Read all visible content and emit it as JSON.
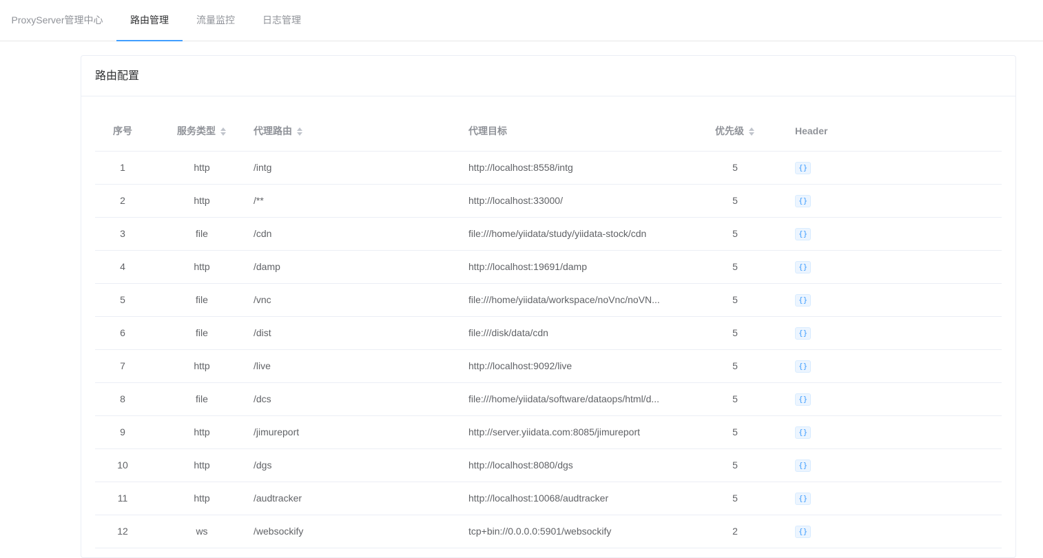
{
  "nav": {
    "brand": "ProxyServer管理中心",
    "tabs": [
      {
        "label": "路由管理",
        "active": true
      },
      {
        "label": "流量监控",
        "active": false
      },
      {
        "label": "日志管理",
        "active": false
      }
    ]
  },
  "card": {
    "title": "路由配置"
  },
  "table": {
    "columns": {
      "index": "序号",
      "type": "服务类型",
      "route": "代理路由",
      "target": "代理目标",
      "priority": "优先级",
      "header": "Header"
    },
    "rows": [
      {
        "index": "1",
        "type": "http",
        "route": "/intg",
        "target": "http://localhost:8558/intg",
        "priority": "5",
        "header": "{}"
      },
      {
        "index": "2",
        "type": "http",
        "route": "/**",
        "target": "http://localhost:33000/",
        "priority": "5",
        "header": "{}"
      },
      {
        "index": "3",
        "type": "file",
        "route": "/cdn",
        "target": "file:///home/yiidata/study/yiidata-stock/cdn",
        "priority": "5",
        "header": "{}"
      },
      {
        "index": "4",
        "type": "http",
        "route": "/damp",
        "target": "http://localhost:19691/damp",
        "priority": "5",
        "header": "{}"
      },
      {
        "index": "5",
        "type": "file",
        "route": "/vnc",
        "target": "file:///home/yiidata/workspace/noVnc/noVN...",
        "priority": "5",
        "header": "{}"
      },
      {
        "index": "6",
        "type": "file",
        "route": "/dist",
        "target": "file:///disk/data/cdn",
        "priority": "5",
        "header": "{}"
      },
      {
        "index": "7",
        "type": "http",
        "route": "/live",
        "target": "http://localhost:9092/live",
        "priority": "5",
        "header": "{}"
      },
      {
        "index": "8",
        "type": "file",
        "route": "/dcs",
        "target": "file:///home/yiidata/software/dataops/html/d...",
        "priority": "5",
        "header": "{}"
      },
      {
        "index": "9",
        "type": "http",
        "route": "/jimureport",
        "target": "http://server.yiidata.com:8085/jimureport",
        "priority": "5",
        "header": "{}"
      },
      {
        "index": "10",
        "type": "http",
        "route": "/dgs",
        "target": "http://localhost:8080/dgs",
        "priority": "5",
        "header": "{}"
      },
      {
        "index": "11",
        "type": "http",
        "route": "/audtracker",
        "target": "http://localhost:10068/audtracker",
        "priority": "5",
        "header": "{}"
      },
      {
        "index": "12",
        "type": "ws",
        "route": "/websockify",
        "target": "tcp+bin://0.0.0.0:5901/websockify",
        "priority": "2",
        "header": "{}"
      }
    ]
  }
}
